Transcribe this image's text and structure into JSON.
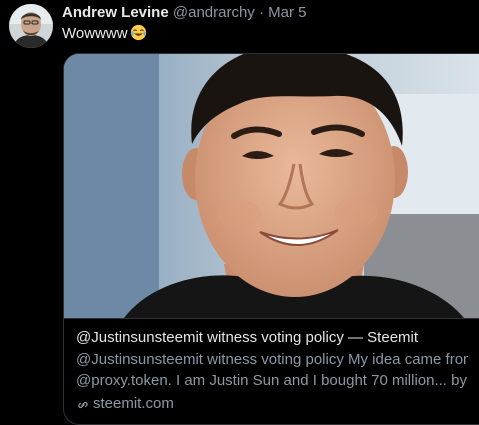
{
  "tweet": {
    "author_name": "Andrew Levine",
    "author_handle": "@andrarchy",
    "separator": "·",
    "date": "Mar 5",
    "text": "Wowwww",
    "emoji_icon": "face-with-tears-of-joy-emoji"
  },
  "card": {
    "image_icon": "portrait-photo",
    "title": "@Justinsunsteemit witness voting policy — Steemit",
    "description_line1": "@Justinsunsteemit witness voting policy My idea came from",
    "description_line2": "@proxy.token. I am Justin Sun and I bought 70 million... by ...",
    "domain": "steemit.com",
    "link_icon": "link-icon"
  },
  "colors": {
    "background": "#000000",
    "primary_text": "#e9e9e9",
    "secondary_text": "#8b98a5",
    "border": "#2f3336"
  }
}
